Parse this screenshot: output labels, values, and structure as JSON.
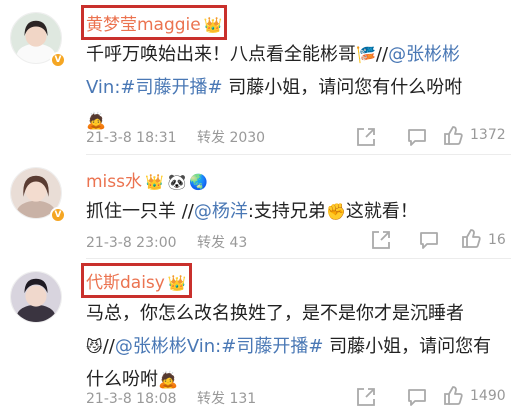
{
  "comments": [
    {
      "username": "黄梦莹maggie",
      "text_a": "千呼万唤始出来！八点看全能彬哥",
      "text_b": "//",
      "mention": "@张彬彬Vin:",
      "hashtag": "#司藤开播#",
      "text_c": " 司藤小姐，请问您有什么吩咐",
      "timestamp": "21-3-8 18:31",
      "repost_label": "转发",
      "repost_count": "2030",
      "like_count": "1372"
    },
    {
      "username": "miss水",
      "text_a": "抓住一只羊 //",
      "mention": "@杨洋",
      "text_b": ":支持兄弟",
      "text_c": "这就看！",
      "timestamp": "21-3-8 23:00",
      "repost_label": "转发",
      "repost_count": "43",
      "like_count": "16"
    },
    {
      "username": "代斯daisy",
      "text_a": "马总，你怎么改名换姓了，是不是你才是沉睡者",
      "text_b": "//",
      "mention": "@张彬彬Vin:",
      "hashtag": "#司藤开播#",
      "text_c": " 司藤小姐，请问您有什么吩咐",
      "timestamp": "21-3-8 18:08",
      "repost_label": "转发",
      "repost_count": "131",
      "like_count": "1490"
    }
  ],
  "icons": {
    "crown": "crown-icon",
    "verified": "v-icon",
    "share": "share-icon",
    "comment": "comment-icon",
    "like": "thumb-up-icon"
  },
  "colors": {
    "username": "#eb7350",
    "link": "#4a78b5",
    "meta": "#999999",
    "highlight_box": "#c9302c"
  }
}
